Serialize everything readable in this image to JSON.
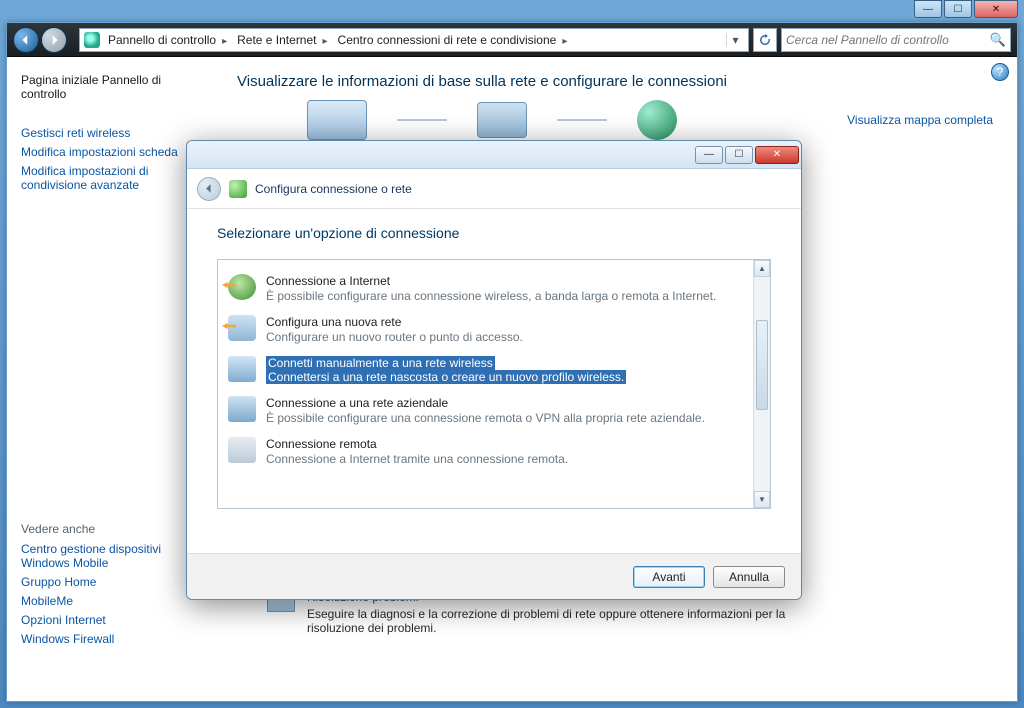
{
  "titlebar": {
    "min": "—",
    "max": "☐",
    "close": "✕"
  },
  "nav": {
    "breadcrumb": [
      "Pannello di controllo",
      "Rete e Internet",
      "Centro connessioni di rete e condivisione"
    ],
    "search_placeholder": "Cerca nel Pannello di controllo"
  },
  "sidebar": {
    "home": "Pagina iniziale Pannello di controllo",
    "links": [
      "Gestisci reti wireless",
      "Modifica impostazioni scheda",
      "Modifica impostazioni di condivisione avanzate"
    ],
    "see_also_hdr": "Vedere anche",
    "see_also": [
      "Centro gestione dispositivi Windows Mobile",
      "Gruppo Home",
      "MobileMe",
      "Opzioni Internet",
      "Windows Firewall"
    ]
  },
  "content": {
    "heading": "Visualizzare le informazioni di base sulla rete e configurare le connessioni",
    "map_link": "Visualizza mappa completa",
    "trouble_title": "Risoluzione problemi",
    "trouble_sub": "Eseguire la diagnosi e la correzione di problemi di rete oppure ottenere informazioni per la risoluzione dei problemi."
  },
  "dialog": {
    "tbtn_min": "—",
    "tbtn_max": "☐",
    "tbtn_close": "✕",
    "title": "Configura connessione o rete",
    "heading": "Selezionare un'opzione di connessione",
    "options": [
      {
        "t": "Connessione a Internet",
        "s": "È possibile configurare una connessione wireless, a banda larga o remota a Internet."
      },
      {
        "t": "Configura una nuova rete",
        "s": "Configurare un nuovo router o punto di accesso."
      },
      {
        "t": "Connetti manualmente a una rete wireless",
        "s": "Connettersi a una rete nascosta o creare un nuovo profilo wireless.",
        "selected": true
      },
      {
        "t": "Connessione a una rete aziendale",
        "s": "È possibile configurare una connessione remota o VPN alla propria rete aziendale."
      },
      {
        "t": "Connessione remota",
        "s": "Connessione a Internet tramite una connessione remota."
      }
    ],
    "next": "Avanti",
    "cancel": "Annulla"
  }
}
